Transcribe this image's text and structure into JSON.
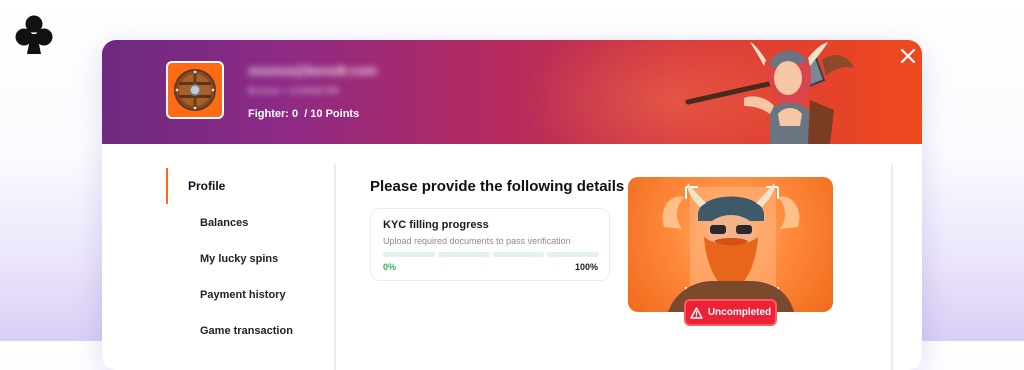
{
  "icons": {
    "brand": "club-icon",
    "avatar": "shield-icon",
    "close": "close-icon",
    "warning": "warning-triangle-icon"
  },
  "colors": {
    "accent": "#ff6a12",
    "status_uncompleted": "#ee2236",
    "progress_green": "#2fb457"
  },
  "profile": {
    "email": "snoova@boredt.com",
    "subline": "Bronze • 123456789",
    "fighter_label": "Fighter: 0",
    "fighter_points": "/ 10 Points"
  },
  "sidebar": {
    "items": [
      {
        "label": "Profile",
        "active": true
      },
      {
        "label": "Balances"
      },
      {
        "label": "My lucky spins"
      },
      {
        "label": "Payment history"
      },
      {
        "label": "Game transaction"
      }
    ]
  },
  "main": {
    "heading": "Please provide the following details",
    "kyc": {
      "title": "KYC filling progress",
      "description": "Upload required documents to pass verification",
      "progress": 0,
      "min_label": "0%",
      "max_label": "100%"
    },
    "status_badge": "Uncompleted"
  }
}
